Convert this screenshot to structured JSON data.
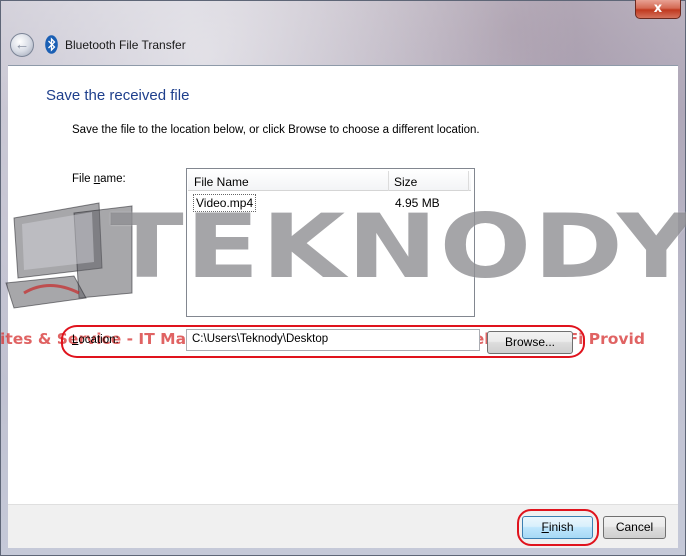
{
  "window": {
    "title": "Bluetooth File Transfer",
    "close_label": "x"
  },
  "page": {
    "heading": "Save the received file",
    "instruction": "Save the file to the location below, or click Browse to choose a different location."
  },
  "file_list": {
    "label_before": "File ",
    "label_accel": "n",
    "label_after": "ame:",
    "columns": [
      "File Name",
      "Size"
    ],
    "rows": [
      {
        "name": "Video.mp4",
        "size": "4.95 MB"
      }
    ]
  },
  "location": {
    "label_accel": "L",
    "label_after": "ocation:",
    "value": "C:\\Users\\Teknody\\Desktop"
  },
  "buttons": {
    "browse": "Browse...",
    "finish_accel": "F",
    "finish_rest": "inish",
    "cancel": "Cancel"
  },
  "watermark": {
    "word": "TEKNODY",
    "tagline": "ites & Service - IT Maintenance - CCTV - Pembuatan Website - WiFi Provid"
  },
  "colors": {
    "heading": "#1e3f8c",
    "annotation_red": "#e0131d",
    "watermark_gray": "#6e6e73",
    "watermark_red": "#d73737"
  },
  "icons": {
    "back": "back-arrow-icon",
    "bluetooth": "bluetooth-icon",
    "close": "close-icon"
  }
}
